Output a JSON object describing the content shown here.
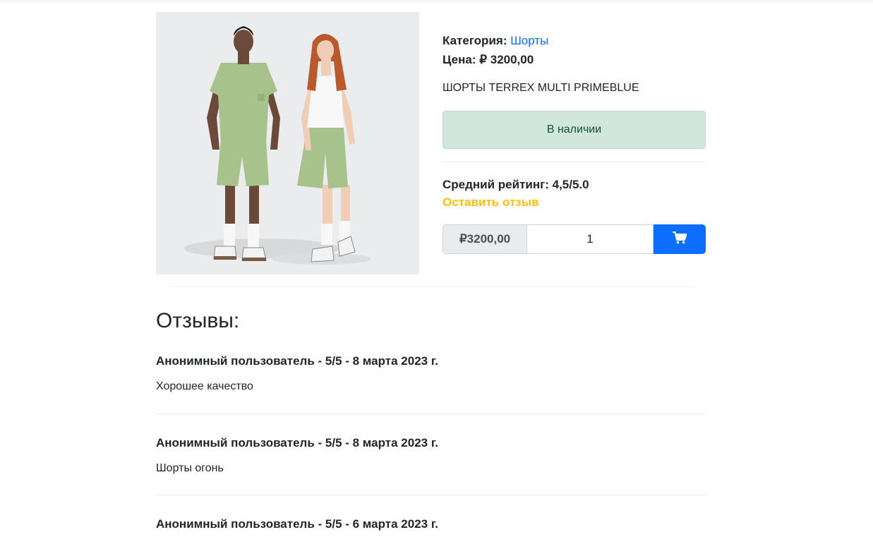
{
  "product": {
    "category_label": "Категория:",
    "category_value": "Шорты",
    "price_label": "Цена:",
    "price_value": "₽ 3200,00",
    "name": "ШОРТЫ TERREX MULTI PRIMEBLUE",
    "stock_status": "В наличии",
    "rating_label": "Средний рейтинг:",
    "rating_value": "4,5/5.0",
    "leave_review": "Оставить отзыв"
  },
  "cart": {
    "price": "₽3200,00",
    "quantity": "1",
    "button_icon": "cart-icon"
  },
  "reviews": {
    "title": "Отзывы:",
    "items": [
      {
        "header": "Анонимный пользователь - 5/5 - 8 марта 2023 г.",
        "text": "Хорошее качество"
      },
      {
        "header": "Анонимный пользователь - 5/5 - 8 марта 2023 г.",
        "text": "Шорты огонь"
      },
      {
        "header": "Анонимный пользователь - 5/5 - 6 марта 2023 г.",
        "text": ""
      }
    ]
  },
  "colors": {
    "primary": "#0d6efd",
    "warning": "#ffc107",
    "success_bg": "#d1e7dd",
    "success_text": "#0f5132",
    "garment": "#a8c28c"
  }
}
